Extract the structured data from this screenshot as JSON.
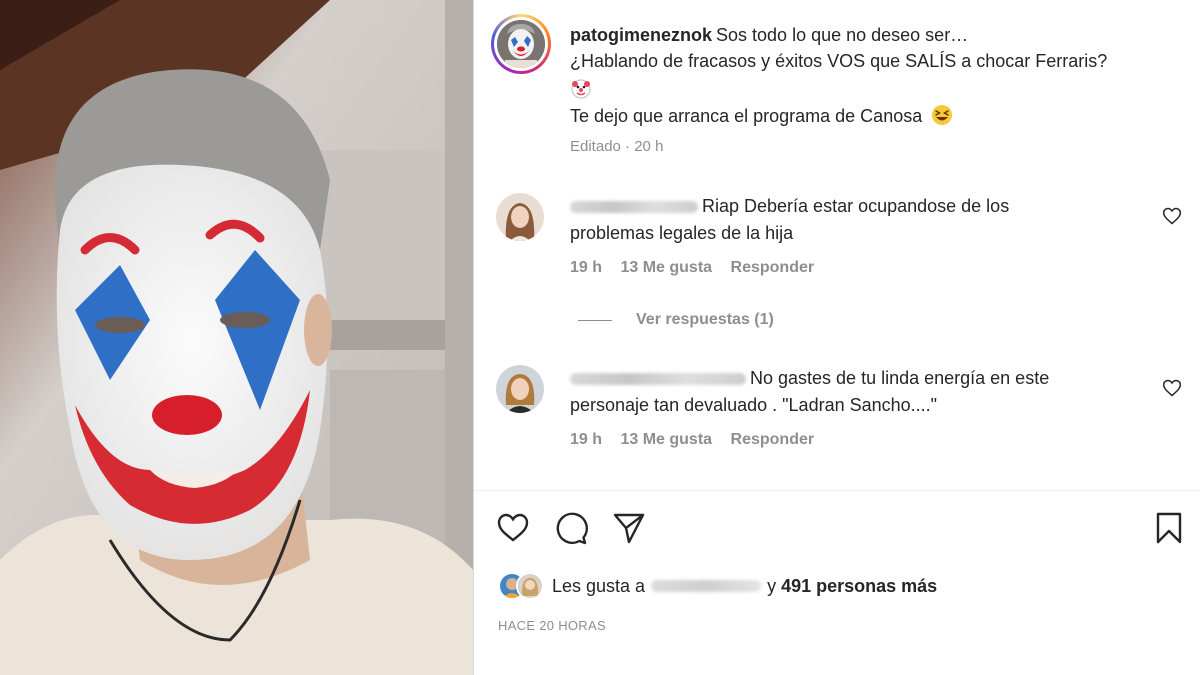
{
  "post": {
    "username": "patogimeneznok",
    "caption_lines": [
      "Sos todo lo que no deseo ser…",
      "¿Hablando de fracasos y éxitos VOS que SALÍS a chocar Ferraris?",
      "Te dejo que arranca el programa de Canosa"
    ],
    "edited_label": "Editado",
    "age": "20 h",
    "meta_separator": "·"
  },
  "comments": [
    {
      "text_line1": "Riap Debería estar ocupandose de los",
      "text_line2": "problemas legales de la hija",
      "time": "19 h",
      "likes": "13 Me gusta",
      "reply_label": "Responder"
    },
    {
      "text_line1": "No gastes de tu linda energía en este",
      "text_line2": "personaje tan devaluado . \"Ladran Sancho....\"",
      "time": "19 h",
      "likes": "13 Me gusta",
      "reply_label": "Responder"
    }
  ],
  "view_replies": "Ver respuestas (1)",
  "likes_bar": {
    "prefix": "Les gusta a",
    "connector": "y",
    "count_text": "491 personas más"
  },
  "timestamp": "HACE 20 HORAS",
  "icons": {
    "like": "heart-icon",
    "comment": "comment-icon",
    "share": "paper-plane-icon",
    "save": "bookmark-icon"
  },
  "colors": {
    "meta_gray": "#8e8e8e",
    "text": "#262626",
    "divider": "#dbdbdb"
  }
}
